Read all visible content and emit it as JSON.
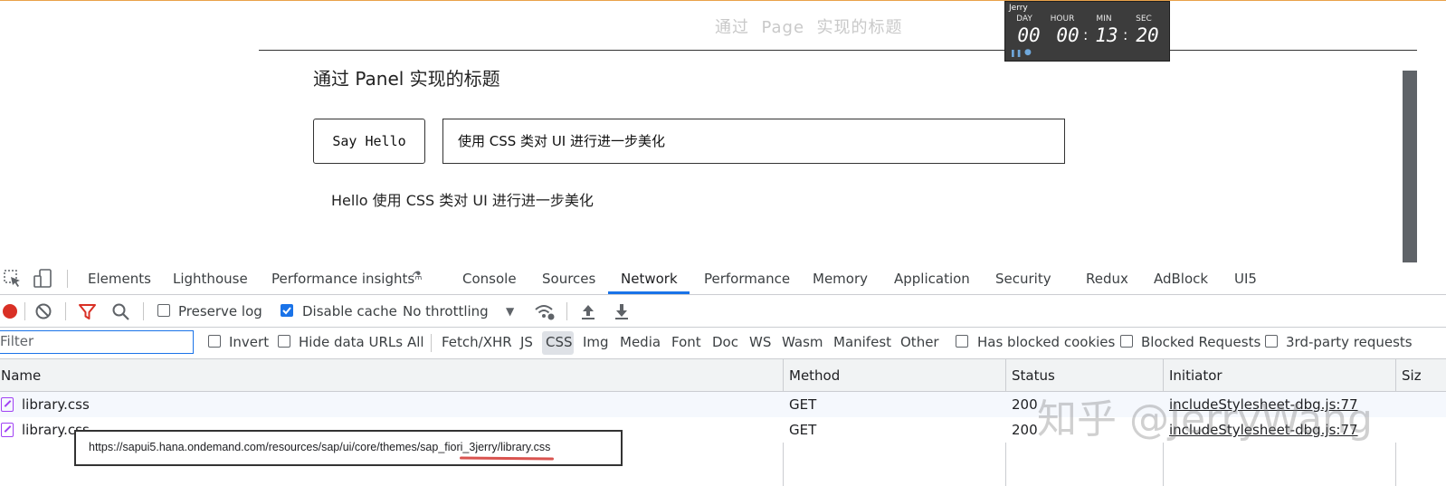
{
  "app": {
    "page_title": "通过  Page  实现的标题",
    "panel_title": "通过 Panel 实现的标题",
    "button_label": "Say Hello",
    "input_value": "使用 CSS 类对 UI 进行进一步美化",
    "hello_text": "Hello 使用 CSS 类对 UI 进行进一步美化"
  },
  "timer": {
    "name": "Jerry",
    "labels": [
      "DAY",
      "HOUR",
      "MIN",
      "SEC"
    ],
    "values": [
      "00",
      "00",
      "13",
      "20"
    ]
  },
  "devtools": {
    "tabs": [
      "Elements",
      "Lighthouse",
      "Performance insights",
      "Console",
      "Sources",
      "Network",
      "Performance",
      "Memory",
      "Application",
      "Security",
      "Redux",
      "AdBlock",
      "UI5"
    ],
    "active_tab": "Network",
    "toolbar": {
      "preserve_log": "Preserve log",
      "disable_cache": "Disable cache",
      "throttling": "No throttling"
    },
    "filter": {
      "placeholder": "Filter",
      "invert": "Invert",
      "hide_data_urls": "Hide data URLs",
      "types": [
        "All",
        "Fetch/XHR",
        "JS",
        "CSS",
        "Img",
        "Media",
        "Font",
        "Doc",
        "WS",
        "Wasm",
        "Manifest",
        "Other"
      ],
      "active_type": "CSS",
      "has_blocked_cookies": "Has blocked cookies",
      "blocked_requests": "Blocked Requests",
      "third_party": "3rd-party requests"
    },
    "columns": [
      "Name",
      "Method",
      "Status",
      "Initiator",
      "Siz"
    ],
    "rows": [
      {
        "name": "library.css",
        "method": "GET",
        "status": "200",
        "initiator": "includeStylesheet-dbg.js:77"
      },
      {
        "name": "library.css",
        "method": "GET",
        "status": "200",
        "initiator": "includeStylesheet-dbg.js:77"
      }
    ],
    "tooltip_url": "https://sapui5.hana.ondemand.com/resources/sap/ui/core/themes/sap_fiori_3jerry/library.css"
  },
  "watermark": "知乎 @JerryWang",
  "colors": {
    "accent": "#1a73e8",
    "record": "#d93025",
    "css_icon": "#a142f4",
    "underline": "#d9534f"
  }
}
